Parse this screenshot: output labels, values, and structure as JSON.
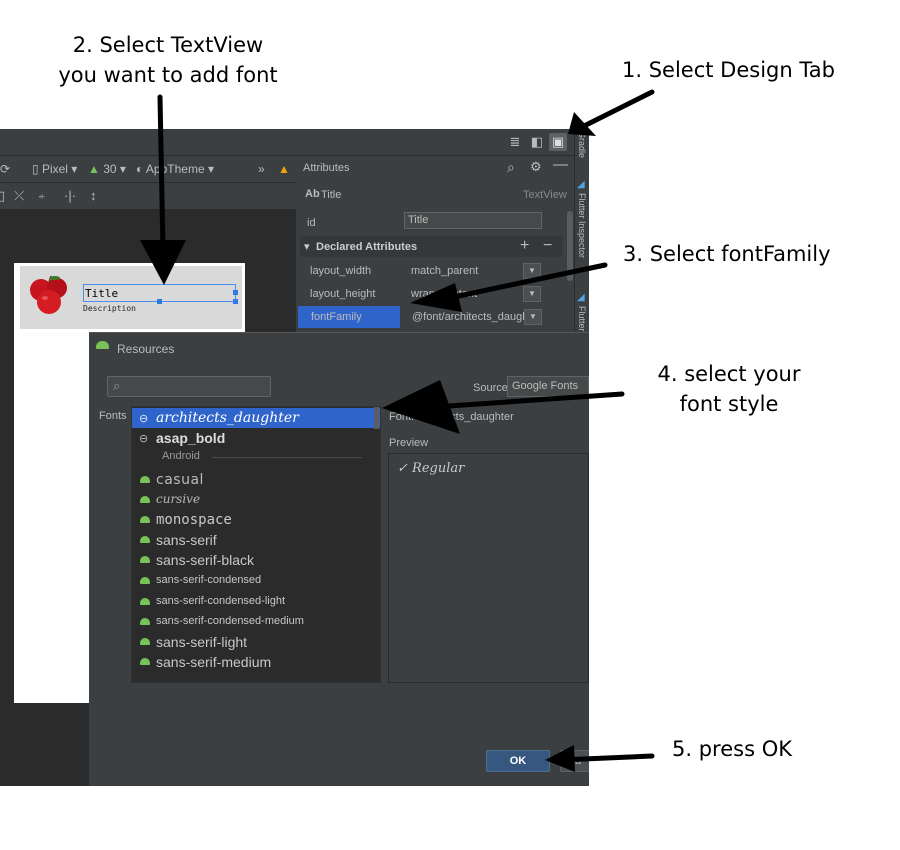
{
  "annotations": {
    "step1": "1. Select Design Tab",
    "step2_line1": "2. Select TextView",
    "step2_line2": "you want to add font",
    "step3": "3. Select fontFamily",
    "step4_line1": "4. select your",
    "step4_line2": "font style",
    "step5": "5. press OK"
  },
  "toolbar": {
    "device": "Pixel",
    "api": "30",
    "theme": "AppTheme",
    "overflow": "»"
  },
  "attributes": {
    "header": "Attributes",
    "widget_prefix": "Ab",
    "widget_name": "Title",
    "widget_type": "TextView",
    "id_label": "id",
    "id_value": "Title",
    "declared_header": "Declared Attributes",
    "rows": [
      {
        "key": "layout_width",
        "value": "match_parent"
      },
      {
        "key": "layout_height",
        "value": "wrap_content"
      },
      {
        "key": "fontFamily",
        "value": "@font/architects_daugh"
      }
    ]
  },
  "side_strip": {
    "gradle": "Gradle",
    "flutter_inspector": "Flutter Inspector",
    "flutter": "Flutter"
  },
  "preview_card": {
    "title": "Title",
    "description": "Description"
  },
  "dialog": {
    "title": "Resources",
    "source_label": "Source",
    "source_value": "Google Fonts",
    "fonts_label": "Fonts",
    "selected_font_label": "Font: architects_daughter",
    "preview_label": "Preview",
    "preview_item": "✓ Regular",
    "ok": "OK",
    "cancel": "Ca",
    "android_group": "Android",
    "fonts_top": [
      {
        "name": "architects_daughter"
      },
      {
        "name": "asap_bold"
      }
    ],
    "fonts_android": [
      {
        "name": "casual"
      },
      {
        "name": "cursive"
      },
      {
        "name": "monospace"
      },
      {
        "name": "sans-serif"
      },
      {
        "name": "sans-serif-black"
      },
      {
        "name": "sans-serif-condensed"
      },
      {
        "name": "sans-serif-condensed-light"
      },
      {
        "name": "sans-serif-condensed-medium"
      },
      {
        "name": "sans-serif-light"
      },
      {
        "name": "sans-serif-medium"
      }
    ]
  },
  "icons": [
    "list-view-icon",
    "split-view-icon",
    "design-view-icon",
    "search-icon",
    "gear-icon",
    "minus-icon",
    "plus-icon",
    "warning-icon",
    "link-icon",
    "android-icon"
  ],
  "colors": {
    "selection": "#2f65ca",
    "ok_button": "#365880",
    "android_green": "#78c257",
    "warning": "#f0a30a"
  }
}
